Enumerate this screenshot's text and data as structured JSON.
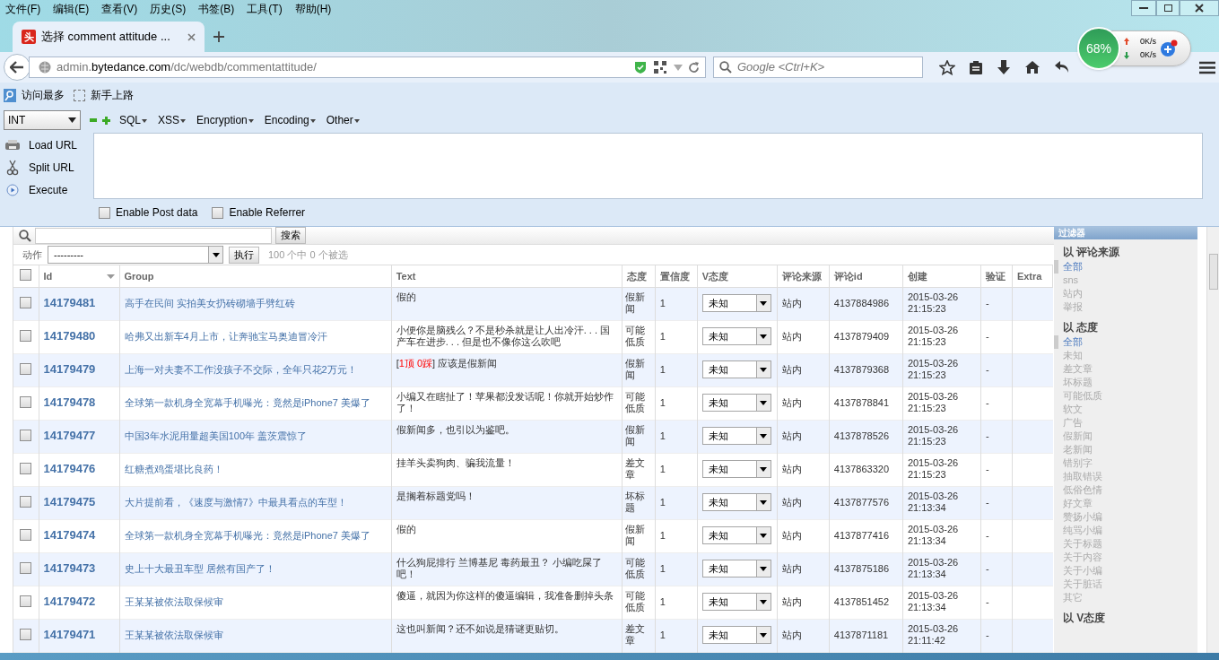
{
  "menu_bar": [
    "文件(F)",
    "编辑(E)",
    "查看(V)",
    "历史(S)",
    "书签(B)",
    "工具(T)",
    "帮助(H)"
  ],
  "tabs": [
    {
      "label": "选择 comment attitude ...",
      "favicon": "头",
      "selected": true
    }
  ],
  "address": {
    "host_prefix": "admin.",
    "host": "bytedance.com",
    "path": "/dc/webdb/commentattitude/"
  },
  "search": {
    "placeholder": "Google <Ctrl+K>"
  },
  "net_widget": {
    "percent": "68%",
    "upload": "0K/s",
    "download": "0K/s"
  },
  "bookmarks": [
    "访问最多",
    "新手上路"
  ],
  "hackbar": {
    "type_select": "INT",
    "menus": [
      "SQL",
      "XSS",
      "Encryption",
      "Encoding",
      "Other"
    ],
    "actions": [
      {
        "label": "Load URL",
        "kind": "load"
      },
      {
        "label": "Split URL",
        "kind": "split"
      },
      {
        "label": "Execute",
        "kind": "execute"
      }
    ],
    "options": [
      {
        "label": "Enable Post data",
        "checked": false
      },
      {
        "label": "Enable Referrer",
        "checked": false
      }
    ]
  },
  "admin": {
    "search_button": "搜索",
    "action_label": "动作",
    "action_select": "---------",
    "run_button": "执行",
    "selection_count": "100 个中 0 个被选",
    "select_all_checked": false,
    "columns": [
      "Id",
      "Group",
      "Text",
      "态度",
      "置信度",
      "V态度",
      "评论来源",
      "评论id",
      "创建",
      "验证",
      "Extra"
    ],
    "rows": [
      {
        "checked": false,
        "id": "14179481",
        "group": "高手在民间 实拍美女扔砖砌墙手劈红砖",
        "text": "假的",
        "attitude": "假新闻",
        "confidence": "1",
        "v_attitude": "未知",
        "source": "站内",
        "comment_id": "4137884986",
        "created": "2015-03-26 21:15:23",
        "verified": "-"
      },
      {
        "checked": false,
        "id": "14179480",
        "group": "哈弗又出新车4月上市，让奔驰宝马奥迪冒冷汗",
        "text": "小便你是脑残么？不是秒杀就是让人出冷汗. . . 国产车在进步. . . 但是也不像你这么吹吧",
        "attitude": "可能低质",
        "confidence": "1",
        "v_attitude": "未知",
        "source": "站内",
        "comment_id": "4137879409",
        "created": "2015-03-26 21:15:23",
        "verified": "-"
      },
      {
        "checked": false,
        "id": "14179479",
        "group": "上海一对夫妻不工作没孩子不交际，全年只花2万元！",
        "text_parts": [
          {
            "text": "[",
            "kind": "plain"
          },
          {
            "text": "1顶 0踩",
            "kind": "highlight"
          },
          {
            "text": "] 应该是假新闻",
            "kind": "plain"
          }
        ],
        "attitude": "假新闻",
        "confidence": "1",
        "v_attitude": "未知",
        "source": "站内",
        "comment_id": "4137879368",
        "created": "2015-03-26 21:15:23",
        "verified": "-"
      },
      {
        "checked": false,
        "id": "14179478",
        "group": "全球第一款机身全宽幕手机曝光：竟然是iPhone7 美爆了",
        "text": "小编又在瞎扯了！苹果都没发话呢！你就开始炒作了！",
        "attitude": "可能低质",
        "confidence": "1",
        "v_attitude": "未知",
        "source": "站内",
        "comment_id": "4137878841",
        "created": "2015-03-26 21:15:23",
        "verified": "-"
      },
      {
        "checked": false,
        "id": "14179477",
        "group": "中国3年水泥用量超美国100年 盖茨震惊了",
        "text": "假新闻多，也引以为鉴吧。",
        "attitude": "假新闻",
        "confidence": "1",
        "v_attitude": "未知",
        "source": "站内",
        "comment_id": "4137878526",
        "created": "2015-03-26 21:15:23",
        "verified": "-"
      },
      {
        "checked": false,
        "id": "14179476",
        "group": "红糖煮鸡蛋堪比良药！",
        "text": "挂羊头卖狗肉、骗我流量！",
        "attitude": "差文章",
        "confidence": "1",
        "v_attitude": "未知",
        "source": "站内",
        "comment_id": "4137863320",
        "created": "2015-03-26 21:15:23",
        "verified": "-"
      },
      {
        "checked": false,
        "id": "14179475",
        "group": "大片提前看，《速度与激情7》中最具看点的车型！",
        "text": "是搁着标题党吗！",
        "attitude": "坏标题",
        "confidence": "1",
        "v_attitude": "未知",
        "source": "站内",
        "comment_id": "4137877576",
        "created": "2015-03-26 21:13:34",
        "verified": "-"
      },
      {
        "checked": false,
        "id": "14179474",
        "group": "全球第一款机身全宽幕手机曝光：竟然是iPhone7 美爆了",
        "text": "假的",
        "attitude": "假新闻",
        "confidence": "1",
        "v_attitude": "未知",
        "source": "站内",
        "comment_id": "4137877416",
        "created": "2015-03-26 21:13:34",
        "verified": "-"
      },
      {
        "checked": false,
        "id": "14179473",
        "group": "史上十大最丑车型 居然有国产了！",
        "text": "什么狗屁排行 兰博基尼 毒药最丑？ 小编吃屎了吧！",
        "attitude": "可能低质",
        "confidence": "1",
        "v_attitude": "未知",
        "source": "站内",
        "comment_id": "4137875186",
        "created": "2015-03-26 21:13:34",
        "verified": "-"
      },
      {
        "checked": false,
        "id": "14179472",
        "group": "王某某被依法取保候审",
        "text": "傻逼，就因为你这样的傻逼编辑，我准备删掉头条",
        "attitude": "可能低质",
        "confidence": "1",
        "v_attitude": "未知",
        "source": "站内",
        "comment_id": "4137851452",
        "created": "2015-03-26 21:13:34",
        "verified": "-"
      },
      {
        "checked": false,
        "id": "14179471",
        "group": "王某某被依法取保候审",
        "text": "这也叫新闻？还不如说是猜谜更贴切。",
        "attitude": "差文章",
        "confidence": "1",
        "v_attitude": "未知",
        "source": "站内",
        "comment_id": "4137871181",
        "created": "2015-03-26 21:11:42",
        "verified": "-"
      }
    ]
  },
  "filter": {
    "title": "过滤器",
    "groups": [
      {
        "heading": "以 评论来源",
        "items": [
          {
            "label": "全部",
            "selected": true
          },
          {
            "label": "sns",
            "selected": false
          },
          {
            "label": "站内",
            "selected": false
          },
          {
            "label": "举报",
            "selected": false
          }
        ]
      },
      {
        "heading": "以 态度",
        "items": [
          {
            "label": "全部",
            "selected": true
          },
          {
            "label": "未知",
            "selected": false
          },
          {
            "label": "差文章",
            "selected": false
          },
          {
            "label": "坏标题",
            "selected": false
          },
          {
            "label": "可能低质",
            "selected": false
          },
          {
            "label": "软文",
            "selected": false
          },
          {
            "label": "广告",
            "selected": false
          },
          {
            "label": "假新闻",
            "selected": false
          },
          {
            "label": "老新闻",
            "selected": false
          },
          {
            "label": "错别字",
            "selected": false
          },
          {
            "label": "抽取错误",
            "selected": false
          },
          {
            "label": "低俗色情",
            "selected": false
          },
          {
            "label": "好文章",
            "selected": false
          },
          {
            "label": "赞扬小编",
            "selected": false
          },
          {
            "label": "纯骂小编",
            "selected": false
          },
          {
            "label": "关于标题",
            "selected": false
          },
          {
            "label": "关于内容",
            "selected": false
          },
          {
            "label": "关于小编",
            "selected": false
          },
          {
            "label": "关于脏话",
            "selected": false
          },
          {
            "label": "其它",
            "selected": false
          }
        ]
      },
      {
        "heading": "以 V态度"
      }
    ]
  }
}
